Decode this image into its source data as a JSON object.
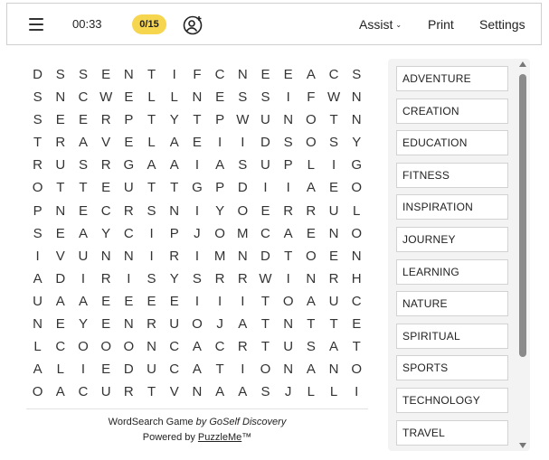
{
  "toolbar": {
    "menu_icon": "hamburger-menu-icon",
    "timer": "00:33",
    "found_count": "0/15",
    "user_icon": "add-user-icon",
    "assist_label": "Assist",
    "assist_caret": "⌄",
    "print_label": "Print",
    "settings_label": "Settings"
  },
  "grid": {
    "rows": [
      "DSSENTIFCNEEACS",
      "SNCWELLNESSIFWN",
      "SEERPTYTPWUNOTN",
      "TRAVELAEIIDSOSY",
      "RUSRGAAIASUPLIG",
      "OTTEUTTGPDIIAEO",
      "PNECRSNIYOERRUL",
      "SEAYCIPJOMCAENO",
      "IVUNNIRIMNDTOEN",
      "ADIRISYSRRWINRH",
      "UAAEEEEIIITOAUC",
      "NEYENRUOJATNTTE",
      "LCOOONCACRTUSAT",
      "ALIEDUCATIONANO",
      "OACURTVNAASJLLI"
    ]
  },
  "words": [
    "ADVENTURE",
    "CREATION",
    "EDUCATION",
    "FITNESS",
    "INSPIRATION",
    "JOURNEY",
    "LEARNING",
    "NATURE",
    "SPIRITUAL",
    "SPORTS",
    "TECHNOLOGY",
    "TRAVEL"
  ],
  "credit": {
    "game_text": "WordSearch Game",
    "by_text": "by GoSelf Discovery",
    "powered_text": "Powered by",
    "powered_link": "PuzzleMe",
    "trademark": "™"
  },
  "colors": {
    "badge": "#f6d54f",
    "wordlist_bg": "#f3f3f3",
    "scroll_thumb": "#8a8a8a"
  }
}
